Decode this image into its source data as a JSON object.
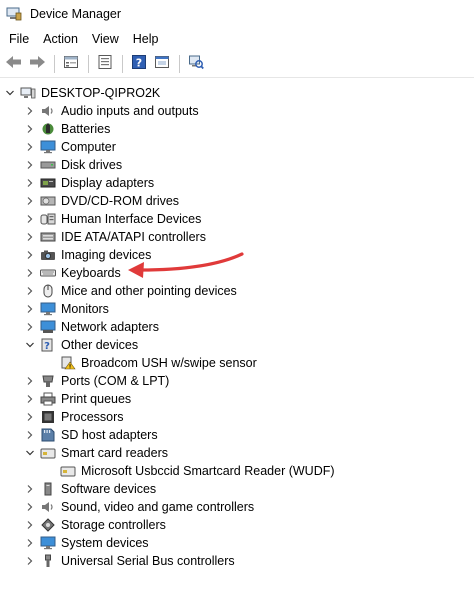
{
  "window": {
    "title": "Device Manager"
  },
  "menu": [
    "File",
    "Action",
    "View",
    "Help"
  ],
  "toolbar": [
    {
      "icon": "back-arrow-icon"
    },
    {
      "icon": "forward-arrow-icon"
    },
    {
      "icon": "properties-sheet-icon"
    },
    {
      "icon": "device-list-icon"
    },
    {
      "icon": "help-icon"
    },
    {
      "icon": "view-device-icon"
    },
    {
      "icon": "scan-hardware-icon"
    }
  ],
  "tree": {
    "root": "DESKTOP-QIPRO2K",
    "items": [
      {
        "label": "Audio inputs and outputs",
        "icon": "speaker-icon"
      },
      {
        "label": "Batteries",
        "icon": "battery-icon"
      },
      {
        "label": "Computer",
        "icon": "computer-icon"
      },
      {
        "label": "Disk drives",
        "icon": "disk-drive-icon"
      },
      {
        "label": "Display adapters",
        "icon": "display-adapter-icon"
      },
      {
        "label": "DVD/CD-ROM drives",
        "icon": "dvd-drive-icon"
      },
      {
        "label": "Human Interface Devices",
        "icon": "hid-icon"
      },
      {
        "label": "IDE ATA/ATAPI controllers",
        "icon": "ide-controller-icon"
      },
      {
        "label": "Imaging devices",
        "icon": "camera-icon"
      },
      {
        "label": "Keyboards",
        "icon": "keyboard-icon"
      },
      {
        "label": "Mice and other pointing devices",
        "icon": "mouse-icon"
      },
      {
        "label": "Monitors",
        "icon": "monitor-icon"
      },
      {
        "label": "Network adapters",
        "icon": "network-adapter-icon"
      },
      {
        "label": "Other devices",
        "icon": "other-devices-icon",
        "expanded": true
      },
      {
        "label": "Broadcom USH w/swipe sensor",
        "icon": "warning-device-icon",
        "child": true
      },
      {
        "label": "Ports (COM & LPT)",
        "icon": "port-icon"
      },
      {
        "label": "Print queues",
        "icon": "printer-icon"
      },
      {
        "label": "Processors",
        "icon": "processor-icon"
      },
      {
        "label": "SD host adapters",
        "icon": "sd-card-icon"
      },
      {
        "label": "Smart card readers",
        "icon": "smart-card-reader-icon",
        "expanded": true
      },
      {
        "label": "Microsoft Usbccid Smartcard Reader (WUDF)",
        "icon": "smart-card-reader-icon",
        "child": true
      },
      {
        "label": "Software devices",
        "icon": "software-device-icon"
      },
      {
        "label": "Sound, video and game controllers",
        "icon": "sound-icon"
      },
      {
        "label": "Storage controllers",
        "icon": "storage-controller-icon"
      },
      {
        "label": "System devices",
        "icon": "system-device-icon"
      },
      {
        "label": "Universal Serial Bus controllers",
        "icon": "usb-icon"
      }
    ]
  },
  "colors": {
    "annotation_arrow": "#e03a3a"
  }
}
